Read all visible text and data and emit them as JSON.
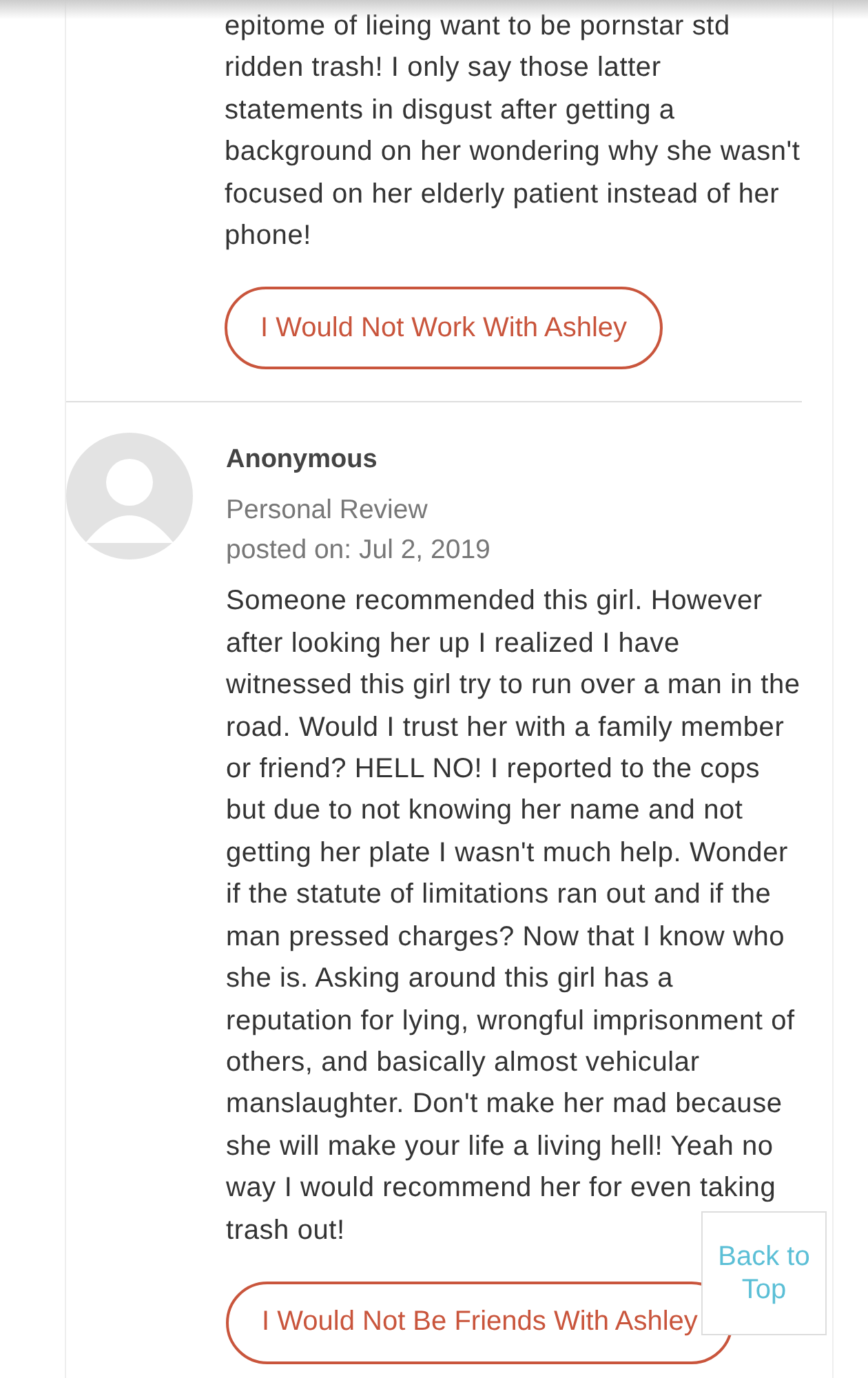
{
  "previous_review": {
    "text_end": "epitome of lieing want to be pornstar std ridden trash! I only say those latter statements in disgust after getting a background on her wondering why she wasn't focused on her elderly patient instead of her phone!",
    "button": "I Would Not Work With Ashley"
  },
  "review": {
    "author": "Anonymous",
    "type": "Personal Review",
    "posted": "posted on: Jul 2, 2019",
    "text": "Someone recommended this girl. However after looking her up I realized I have witnessed this girl try to run over a man in the road. Would I trust her with a family member or friend? HELL NO! I reported to the cops but due to not knowing her name and not getting her plate I wasn't much help. Wonder if the statute of limitations ran out and if the man pressed charges? Now that I know who she is. Asking around this girl has a reputation for lying, wrongful imprisonment of others, and basically almost vehicular manslaughter. Don't make her mad because she will make your life a living hell! Yeah no way I would recommend her for even taking trash out!",
    "button": "I Would Not Be Friends With Ashley"
  },
  "back_to_top": "Back to Top"
}
